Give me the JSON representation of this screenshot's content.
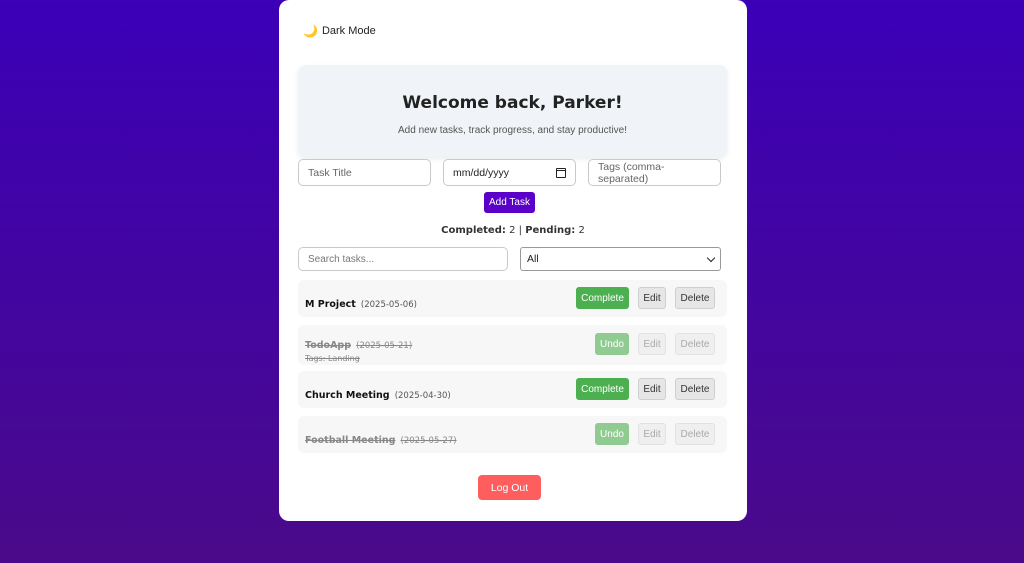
{
  "toggle": {
    "icon": "moon-icon",
    "label": "Dark Mode"
  },
  "hero": {
    "title": "Welcome back, Parker!",
    "subtitle": "Add new tasks, track progress, and stay productive!"
  },
  "form": {
    "title_placeholder": "Task Title",
    "date_value": "mm/dd/yyyy",
    "tags_placeholder": "Tags (comma-separated)",
    "add_label": "Add Task"
  },
  "stats": {
    "completed_label": "Completed:",
    "completed": "2",
    "separator": "|",
    "pending_label": "Pending:",
    "pending": "2"
  },
  "filters": {
    "search_placeholder": "Search tasks...",
    "select_value": "All"
  },
  "tasks": [
    {
      "name": "M Project",
      "date": "(2025-05-06)",
      "tags": "",
      "done": false,
      "action": "Complete",
      "edit": "Edit",
      "delete": "Delete"
    },
    {
      "name": "TodoApp",
      "date": "(2025-05-21)",
      "tags": "Tags: Landing",
      "done": true,
      "action": "Undo",
      "edit": "Edit",
      "delete": "Delete"
    },
    {
      "name": "Church Meeting",
      "date": "(2025-04-30)",
      "tags": "",
      "done": false,
      "action": "Complete",
      "edit": "Edit",
      "delete": "Delete"
    },
    {
      "name": "Football Meeting",
      "date": "(2025-05-27)",
      "tags": "",
      "done": true,
      "action": "Undo",
      "edit": "Edit",
      "delete": "Delete"
    }
  ],
  "logout_label": "Log Out",
  "colors": {
    "background": "#3b00b7",
    "accent": "#5a00c9",
    "complete": "#4caf50",
    "logout": "#ff5e5e"
  }
}
